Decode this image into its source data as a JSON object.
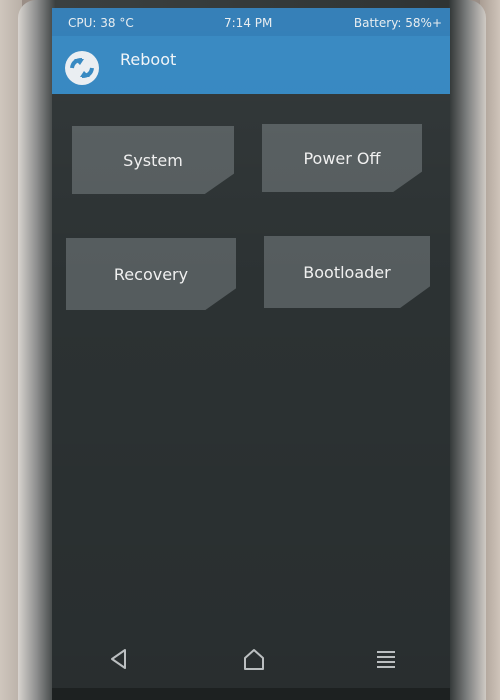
{
  "status_bar": {
    "cpu": "CPU: 38 °C",
    "time": "7:14 PM",
    "battery": "Battery: 58%+"
  },
  "header": {
    "title": "Reboot",
    "logo_icon": "twrp-logo-icon"
  },
  "buttons": {
    "system": "System",
    "power_off": "Power Off",
    "recovery": "Recovery",
    "bootloader": "Bootloader"
  },
  "nav": {
    "back_icon": "back-triangle-icon",
    "home_icon": "home-icon",
    "menu_icon": "menu-lines-icon"
  },
  "colors": {
    "header": "#3386c0",
    "background": "#2c3233",
    "button": "#555c5e"
  }
}
